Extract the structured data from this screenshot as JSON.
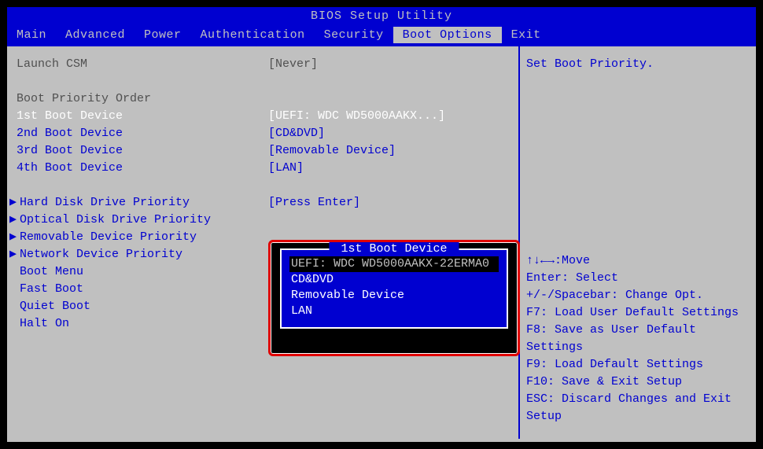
{
  "title": "BIOS Setup Utility",
  "tabs": [
    "Main",
    "Advanced",
    "Power",
    "Authentication",
    "Security",
    "Boot Options",
    "Exit"
  ],
  "active_tab": "Boot Options",
  "main": {
    "launch_csm": {
      "label": "Launch CSM",
      "value": "[Never]"
    },
    "boot_priority_header": "Boot Priority Order",
    "boot_devices": [
      {
        "label": "1st Boot Device",
        "value": "[UEFI: WDC WD5000AAKX...]",
        "selected": true
      },
      {
        "label": "2nd Boot Device",
        "value": "[CD&DVD]"
      },
      {
        "label": "3rd Boot Device",
        "value": "[Removable Device]"
      },
      {
        "label": "4th Boot Device",
        "value": "[LAN]"
      }
    ],
    "submenu_items": [
      {
        "label": "Hard Disk Drive Priority",
        "value": "[Press Enter]"
      },
      {
        "label": "Optical Disk Drive Priority",
        "value": ""
      },
      {
        "label": "Removable Device Priority",
        "value": ""
      },
      {
        "label": "Network Device Priority",
        "value": ""
      },
      {
        "label": "Boot Menu",
        "value": ""
      },
      {
        "label": "Fast Boot",
        "value": ""
      },
      {
        "label": "Quiet Boot",
        "value": ""
      },
      {
        "label": "Halt On",
        "value": ""
      }
    ]
  },
  "popup": {
    "title": " 1st Boot Device ",
    "items": [
      "UEFI: WDC WD5000AAKX-22ERMA0",
      "CD&DVD",
      "Removable Device",
      "LAN"
    ],
    "selected_index": 0
  },
  "side": {
    "description": "Set Boot Priority.",
    "help": [
      "↑↓←→:Move",
      "Enter: Select",
      "+/-/Spacebar: Change Opt.",
      "F7: Load User Default Settings",
      "F8: Save as User Default Settings",
      "F9: Load Default Settings",
      "F10: Save & Exit Setup",
      "ESC: Discard Changes and Exit Setup"
    ]
  }
}
